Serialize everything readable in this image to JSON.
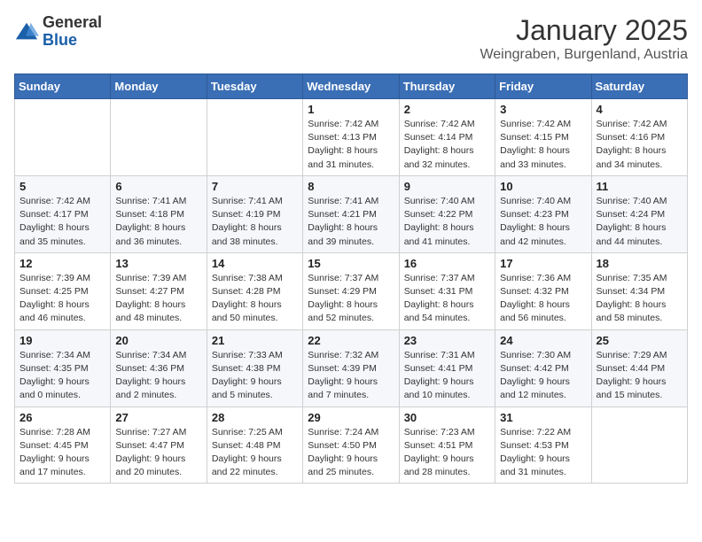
{
  "logo": {
    "general": "General",
    "blue": "Blue"
  },
  "title": "January 2025",
  "location": "Weingraben, Burgenland, Austria",
  "days_of_week": [
    "Sunday",
    "Monday",
    "Tuesday",
    "Wednesday",
    "Thursday",
    "Friday",
    "Saturday"
  ],
  "weeks": [
    [
      {
        "day": "",
        "info": ""
      },
      {
        "day": "",
        "info": ""
      },
      {
        "day": "",
        "info": ""
      },
      {
        "day": "1",
        "info": "Sunrise: 7:42 AM\nSunset: 4:13 PM\nDaylight: 8 hours and 31 minutes."
      },
      {
        "day": "2",
        "info": "Sunrise: 7:42 AM\nSunset: 4:14 PM\nDaylight: 8 hours and 32 minutes."
      },
      {
        "day": "3",
        "info": "Sunrise: 7:42 AM\nSunset: 4:15 PM\nDaylight: 8 hours and 33 minutes."
      },
      {
        "day": "4",
        "info": "Sunrise: 7:42 AM\nSunset: 4:16 PM\nDaylight: 8 hours and 34 minutes."
      }
    ],
    [
      {
        "day": "5",
        "info": "Sunrise: 7:42 AM\nSunset: 4:17 PM\nDaylight: 8 hours and 35 minutes."
      },
      {
        "day": "6",
        "info": "Sunrise: 7:41 AM\nSunset: 4:18 PM\nDaylight: 8 hours and 36 minutes."
      },
      {
        "day": "7",
        "info": "Sunrise: 7:41 AM\nSunset: 4:19 PM\nDaylight: 8 hours and 38 minutes."
      },
      {
        "day": "8",
        "info": "Sunrise: 7:41 AM\nSunset: 4:21 PM\nDaylight: 8 hours and 39 minutes."
      },
      {
        "day": "9",
        "info": "Sunrise: 7:40 AM\nSunset: 4:22 PM\nDaylight: 8 hours and 41 minutes."
      },
      {
        "day": "10",
        "info": "Sunrise: 7:40 AM\nSunset: 4:23 PM\nDaylight: 8 hours and 42 minutes."
      },
      {
        "day": "11",
        "info": "Sunrise: 7:40 AM\nSunset: 4:24 PM\nDaylight: 8 hours and 44 minutes."
      }
    ],
    [
      {
        "day": "12",
        "info": "Sunrise: 7:39 AM\nSunset: 4:25 PM\nDaylight: 8 hours and 46 minutes."
      },
      {
        "day": "13",
        "info": "Sunrise: 7:39 AM\nSunset: 4:27 PM\nDaylight: 8 hours and 48 minutes."
      },
      {
        "day": "14",
        "info": "Sunrise: 7:38 AM\nSunset: 4:28 PM\nDaylight: 8 hours and 50 minutes."
      },
      {
        "day": "15",
        "info": "Sunrise: 7:37 AM\nSunset: 4:29 PM\nDaylight: 8 hours and 52 minutes."
      },
      {
        "day": "16",
        "info": "Sunrise: 7:37 AM\nSunset: 4:31 PM\nDaylight: 8 hours and 54 minutes."
      },
      {
        "day": "17",
        "info": "Sunrise: 7:36 AM\nSunset: 4:32 PM\nDaylight: 8 hours and 56 minutes."
      },
      {
        "day": "18",
        "info": "Sunrise: 7:35 AM\nSunset: 4:34 PM\nDaylight: 8 hours and 58 minutes."
      }
    ],
    [
      {
        "day": "19",
        "info": "Sunrise: 7:34 AM\nSunset: 4:35 PM\nDaylight: 9 hours and 0 minutes."
      },
      {
        "day": "20",
        "info": "Sunrise: 7:34 AM\nSunset: 4:36 PM\nDaylight: 9 hours and 2 minutes."
      },
      {
        "day": "21",
        "info": "Sunrise: 7:33 AM\nSunset: 4:38 PM\nDaylight: 9 hours and 5 minutes."
      },
      {
        "day": "22",
        "info": "Sunrise: 7:32 AM\nSunset: 4:39 PM\nDaylight: 9 hours and 7 minutes."
      },
      {
        "day": "23",
        "info": "Sunrise: 7:31 AM\nSunset: 4:41 PM\nDaylight: 9 hours and 10 minutes."
      },
      {
        "day": "24",
        "info": "Sunrise: 7:30 AM\nSunset: 4:42 PM\nDaylight: 9 hours and 12 minutes."
      },
      {
        "day": "25",
        "info": "Sunrise: 7:29 AM\nSunset: 4:44 PM\nDaylight: 9 hours and 15 minutes."
      }
    ],
    [
      {
        "day": "26",
        "info": "Sunrise: 7:28 AM\nSunset: 4:45 PM\nDaylight: 9 hours and 17 minutes."
      },
      {
        "day": "27",
        "info": "Sunrise: 7:27 AM\nSunset: 4:47 PM\nDaylight: 9 hours and 20 minutes."
      },
      {
        "day": "28",
        "info": "Sunrise: 7:25 AM\nSunset: 4:48 PM\nDaylight: 9 hours and 22 minutes."
      },
      {
        "day": "29",
        "info": "Sunrise: 7:24 AM\nSunset: 4:50 PM\nDaylight: 9 hours and 25 minutes."
      },
      {
        "day": "30",
        "info": "Sunrise: 7:23 AM\nSunset: 4:51 PM\nDaylight: 9 hours and 28 minutes."
      },
      {
        "day": "31",
        "info": "Sunrise: 7:22 AM\nSunset: 4:53 PM\nDaylight: 9 hours and 31 minutes."
      },
      {
        "day": "",
        "info": ""
      }
    ]
  ]
}
